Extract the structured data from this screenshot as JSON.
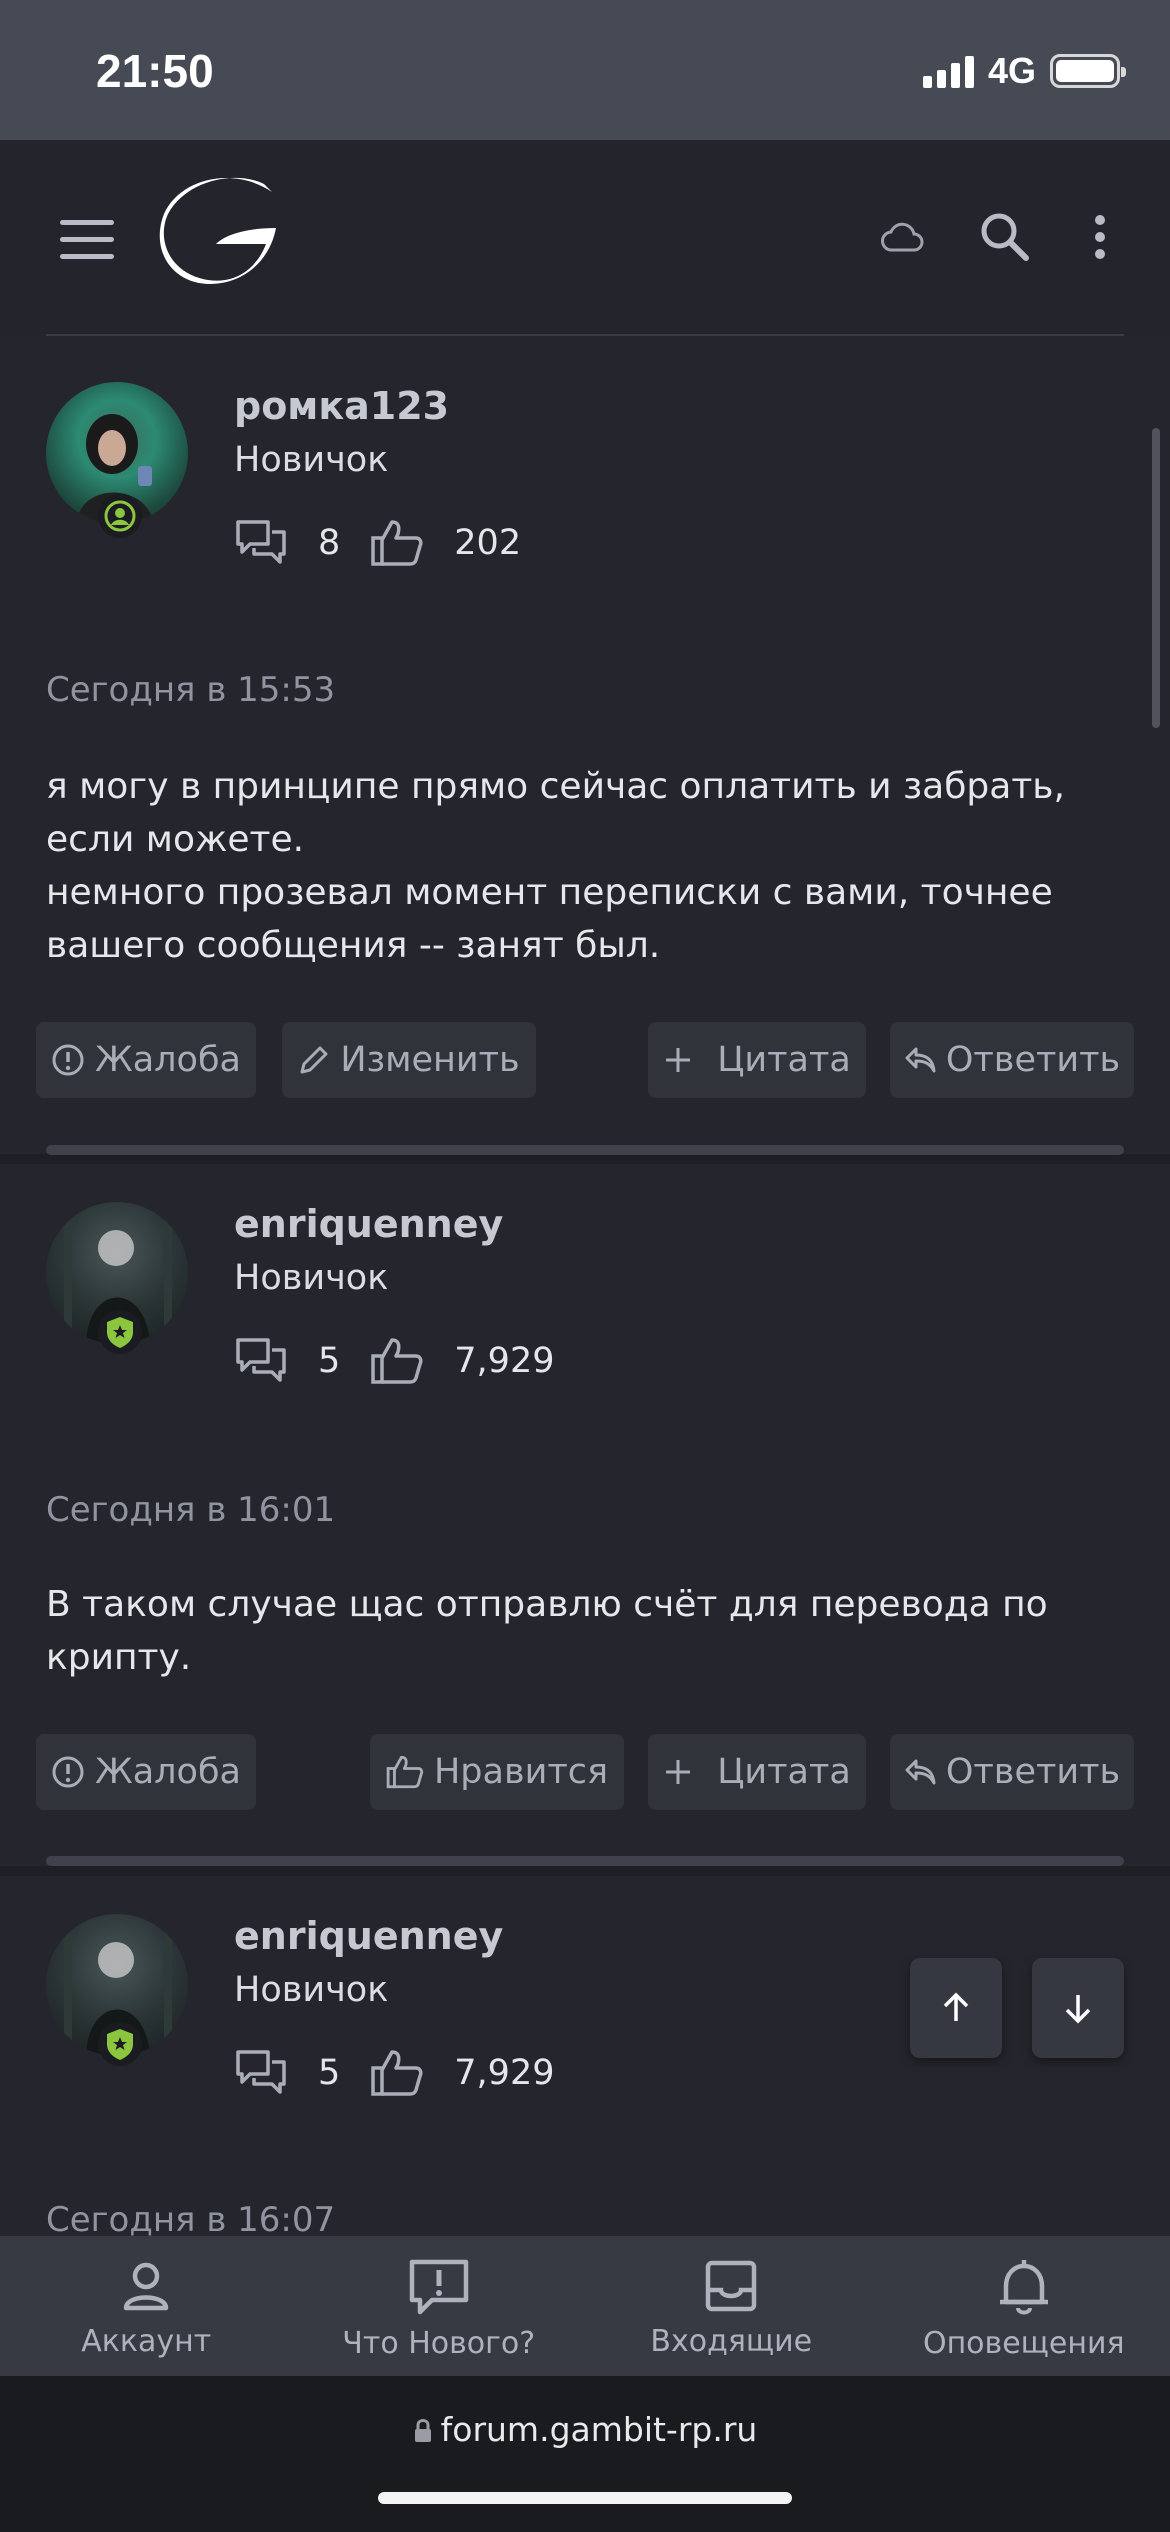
{
  "status_bar": {
    "time": "21:50",
    "network": "4G"
  },
  "header": {
    "icons": [
      "menu-icon",
      "cloud-icon",
      "search-icon",
      "more-vertical-icon"
    ]
  },
  "posts": [
    {
      "username": "ромка123",
      "user_title": "Новичок",
      "messages_count": "8",
      "reactions_count": "202",
      "time": "Сегодня в 15:53",
      "body_lines": [
        "я могу в принципе прямо сейчас оплатить и забрать,",
        "если можете.",
        "немного прозевал момент переписки с вами, точнее",
        "вашего сообщения -- занят был."
      ],
      "actions": {
        "report": "Жалоба",
        "edit": "Изменить",
        "quote": "Цитата",
        "reply": "Ответить"
      }
    },
    {
      "username": "enriquenney",
      "user_title": "Новичок",
      "messages_count": "5",
      "reactions_count": "7,929",
      "time": "Сегодня в 16:01",
      "body_lines": [
        "В таком случае щас отправлю счёт для перевода по",
        "крипту."
      ],
      "actions": {
        "report": "Жалоба",
        "like": "Нравится",
        "quote": "Цитата",
        "reply": "Ответить"
      }
    },
    {
      "username": "enriquenney",
      "user_title": "Новичок",
      "messages_count": "5",
      "reactions_count": "7,929",
      "time": "Сегодня в 16:07"
    }
  ],
  "tabbar": {
    "account": "Аккаунт",
    "whats_new": "Что Нового?",
    "inbox": "Входящие",
    "alerts": "Оповещения"
  },
  "browser": {
    "url": "forum.gambit-rp.ru"
  },
  "colors": {
    "accent_badge": "#8cc63f",
    "background": "#1e1f25",
    "panel": "#25262d"
  }
}
